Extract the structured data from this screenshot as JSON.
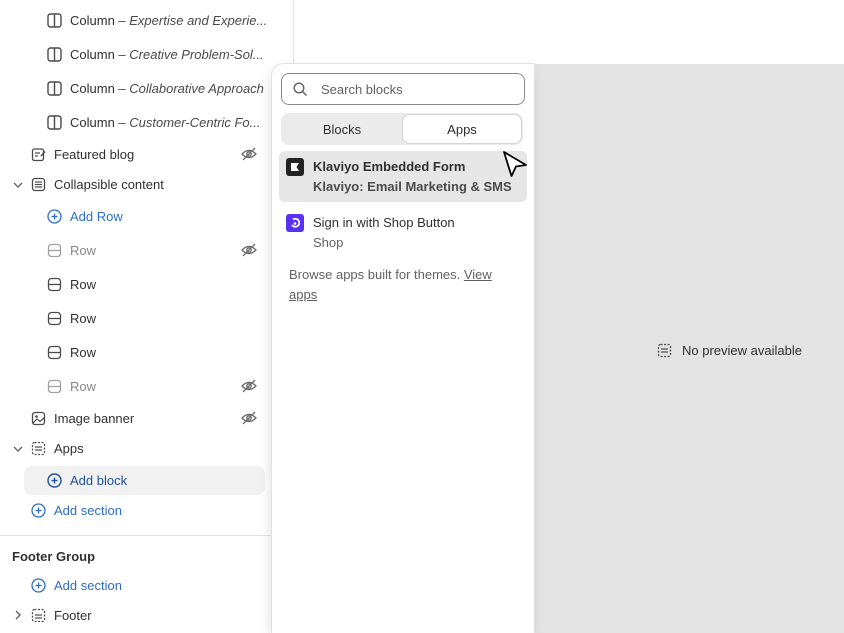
{
  "sidebar": {
    "columns": [
      {
        "prefix": "Column",
        "detail": "– Expertise and Experie..."
      },
      {
        "prefix": "Column",
        "detail": "– Creative Problem-Sol..."
      },
      {
        "prefix": "Column",
        "detail": "– Collaborative Approach"
      },
      {
        "prefix": "Column",
        "detail": "– Customer-Centric Fo..."
      }
    ],
    "featured_blog": "Featured blog",
    "collapsible_content": "Collapsible content",
    "add_row": "Add Row",
    "rows": [
      "Row",
      "Row",
      "Row",
      "Row",
      "Row"
    ],
    "image_banner": "Image banner",
    "apps": "Apps",
    "add_block": "Add block",
    "add_section": "Add section",
    "footer_group": "Footer Group",
    "footer_add_section": "Add section",
    "footer": "Footer"
  },
  "popover": {
    "search_placeholder": "Search blocks",
    "tabs": [
      "Blocks",
      "Apps"
    ],
    "active_tab": "Apps",
    "apps": [
      {
        "name": "Klaviyo Embedded Form",
        "provider": "Klaviyo: Email Marketing & SMS",
        "icon": "klaviyo-icon",
        "color": "#222222"
      },
      {
        "name": "Sign in with Shop Button",
        "provider": "Shop",
        "icon": "shop-icon",
        "color": "#5a31f4"
      }
    ],
    "browse_text": "Browse apps built for themes. ",
    "browse_link": "View apps"
  },
  "preview": {
    "no_preview": "No preview available"
  },
  "colors": {
    "accent": "#2c6ecb",
    "preview_bg": "#e3e3e3"
  }
}
